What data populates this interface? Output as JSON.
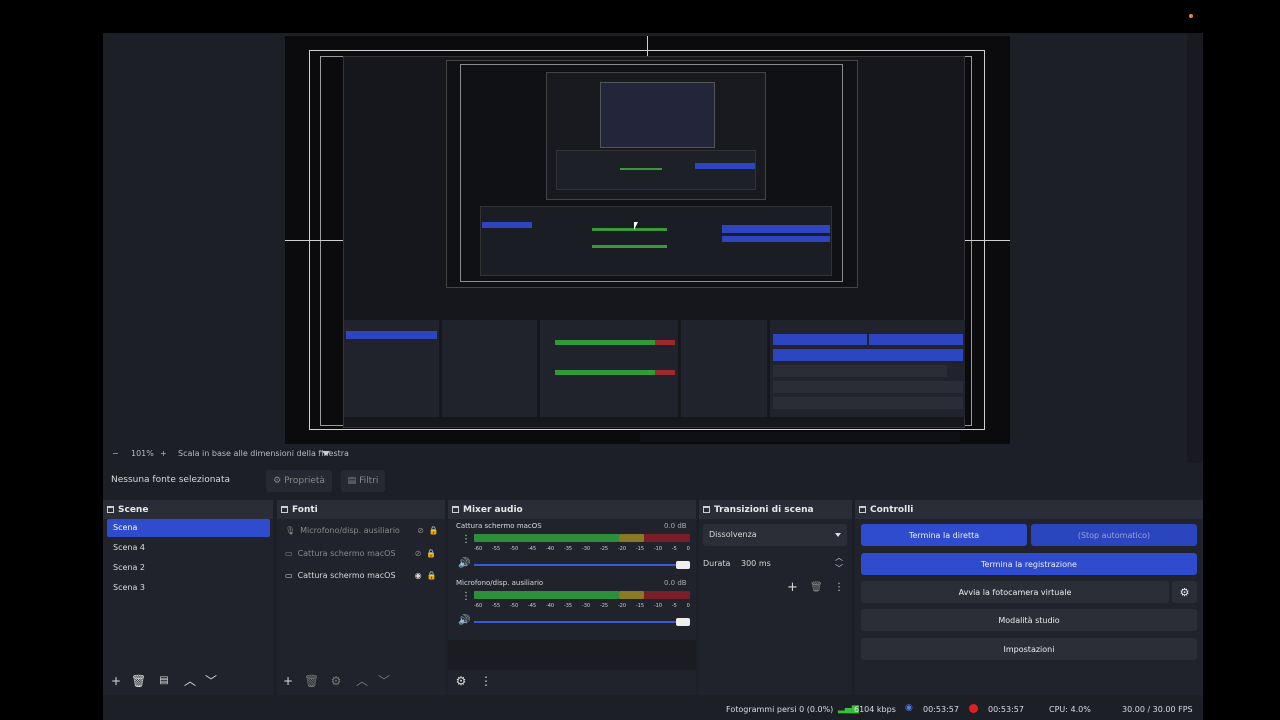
{
  "zoom": {
    "minus": "−",
    "value": "101%",
    "plus": "+",
    "scale_label": "Scala in base alle dimensioni della finestra"
  },
  "toolbar": {
    "no_source": "Nessuna fonte selezionata",
    "properties": "Proprietà",
    "filters": "Filtri"
  },
  "scenes": {
    "title": "Scene",
    "items": [
      "Scena",
      "Scena 4",
      "Scena 2",
      "Scena 3"
    ],
    "selected": 0
  },
  "sources": {
    "title": "Fonti",
    "items": [
      {
        "label": "Microfono/disp. ausiliario",
        "icon": "microphone-icon"
      },
      {
        "label": "Cattura schermo macOS",
        "icon": "monitor-icon"
      },
      {
        "label": "Cattura schermo macOS",
        "icon": "monitor-icon"
      }
    ]
  },
  "mixer": {
    "title": "Mixer audio",
    "channels": [
      {
        "name": "Cattura schermo macOS",
        "db": "0.0 dB",
        "level": 1.0
      },
      {
        "name": "Microfono/disp. ausiliario",
        "db": "0.0 dB",
        "level": 1.0
      }
    ],
    "ticks": [
      "-60",
      "-55",
      "-50",
      "-45",
      "-40",
      "-35",
      "-30",
      "-25",
      "-20",
      "-15",
      "-10",
      "-5",
      "0"
    ]
  },
  "transitions": {
    "title": "Transizioni di scena",
    "type": "Dissolvenza",
    "duration_label": "Durata",
    "duration": "300 ms"
  },
  "controls": {
    "title": "Controlli",
    "stop_stream": "Termina la diretta",
    "auto_stop": "(Stop automatico)",
    "stop_record": "Termina la registrazione",
    "virtual_cam": "Avvia la fotocamera virtuale",
    "studio": "Modalità studio",
    "settings": "Impostazioni"
  },
  "status": {
    "dropped": "Fotogrammi persi 0 (0.0%)",
    "bitrate": "6104 kbps",
    "stream_time": "00:53:57",
    "rec_time": "00:53:57",
    "cpu": "CPU: 4.0%",
    "fps": "30.00 / 30.00 FPS"
  },
  "colors": {
    "accent": "#2f4cce",
    "rec": "#e02020",
    "bitrate": "#3cbf3c"
  }
}
